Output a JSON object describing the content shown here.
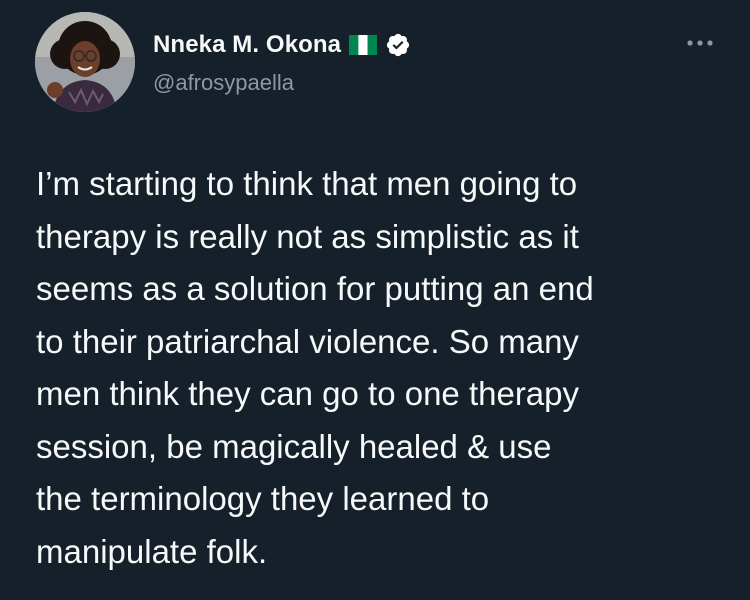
{
  "author": {
    "display_name": "Nneka M. Okona",
    "handle": "@afrosypaella",
    "flag_icon": "nigeria-flag-icon",
    "verified_icon": "verified-badge-icon",
    "verified_color": "#ffffff"
  },
  "menu": {
    "icon": "more-options-icon"
  },
  "tweet": {
    "lines": [
      "I’m starting to think that men going to",
      "therapy is really not as simplistic as it",
      "seems as a solution for putting an end",
      "to their patriarchal violence. So many",
      "men think they can go to one therapy",
      "session, be magically healed & use",
      "the terminology they learned to",
      "manipulate folk."
    ]
  },
  "colors": {
    "background": "#15202b",
    "text_primary": "#f7f9f9",
    "text_secondary": "#8b98a5",
    "flag_green": "#008751"
  }
}
